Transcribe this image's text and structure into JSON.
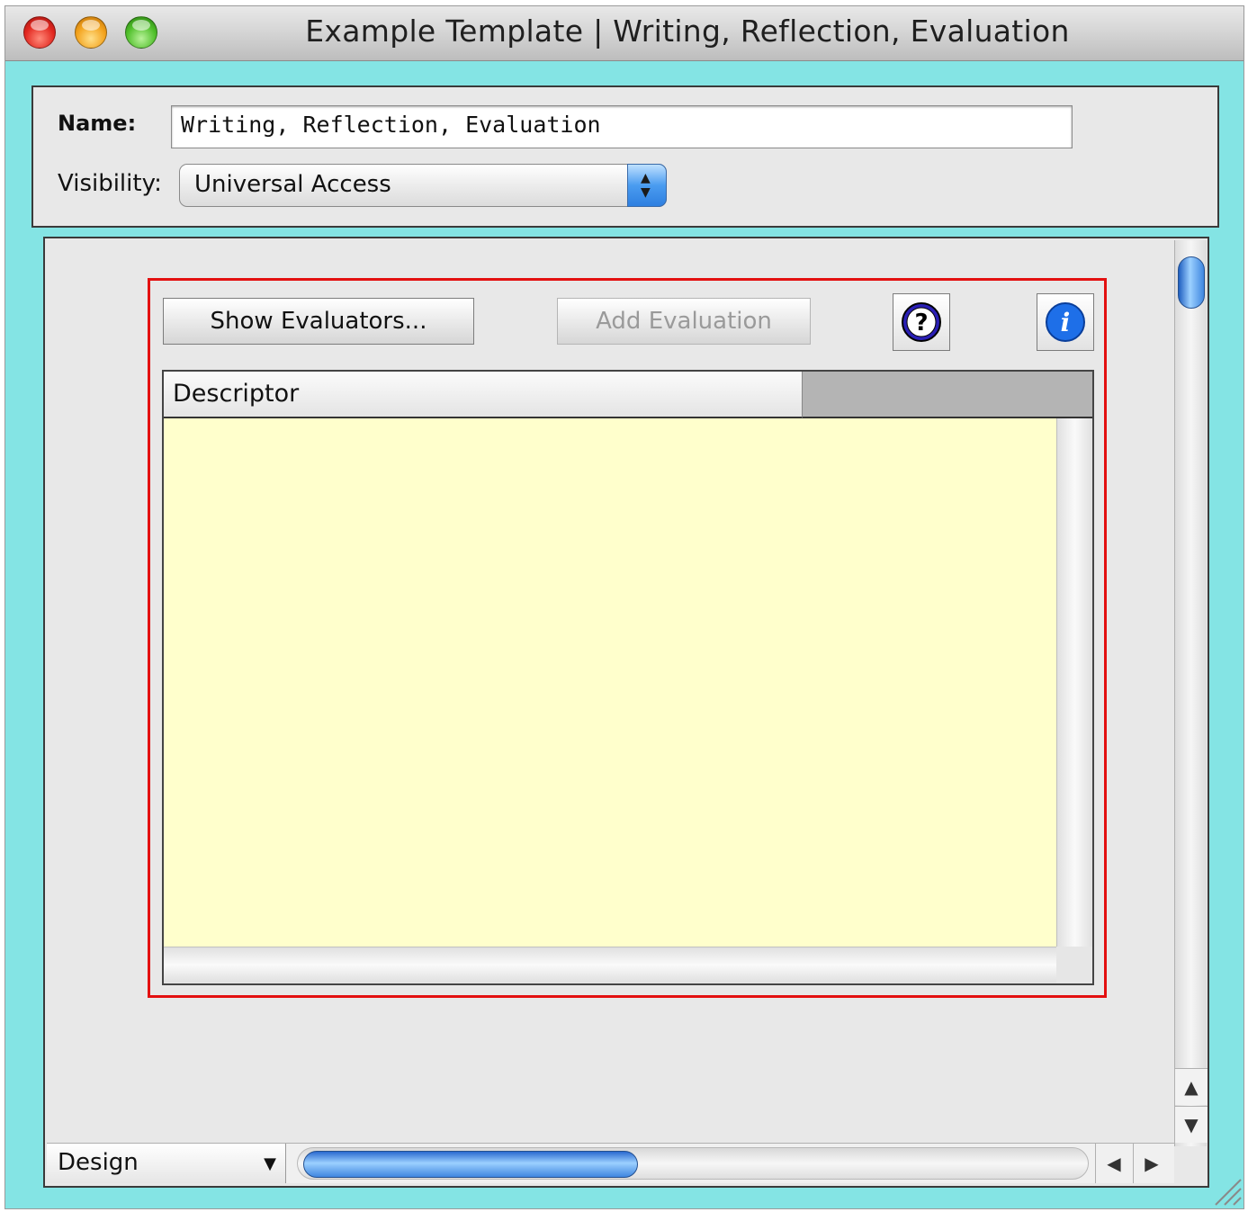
{
  "window": {
    "title": "Example Template | Writing, Reflection, Evaluation"
  },
  "form": {
    "name_label": "Name:",
    "name_value": "Writing, Reflection, Evaluation",
    "visibility_label": "Visibility:",
    "visibility_value": "Universal Access"
  },
  "toolbar": {
    "show_evaluators_label": "Show Evaluators...",
    "add_evaluation_label": "Add Evaluation",
    "help_icon": "help-icon",
    "info_icon": "info-icon"
  },
  "table": {
    "columns": [
      "Descriptor",
      ""
    ],
    "rows": []
  },
  "footer": {
    "mode_value": "Design"
  },
  "colors": {
    "window_background": "#84e4e4",
    "frame_border": "#e31010",
    "table_body": "#ffffcc",
    "help_icon": "#2a1fb5",
    "info_icon": "#1e6fe8"
  }
}
